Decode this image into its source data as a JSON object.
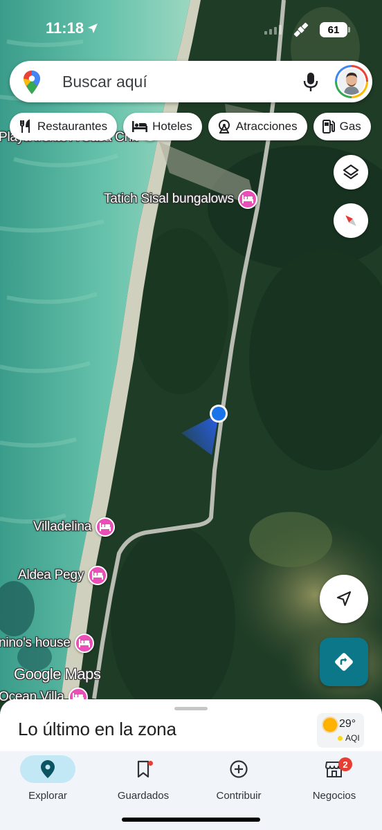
{
  "status_bar": {
    "time": "11:18",
    "battery": "61"
  },
  "search": {
    "placeholder": "Buscar aquí"
  },
  "chips": [
    {
      "label": "Restaurantes",
      "icon": "fork-knife-icon"
    },
    {
      "label": "Hoteles",
      "icon": "bed-icon"
    },
    {
      "label": "Atracciones",
      "icon": "attraction-icon"
    },
    {
      "label": "Gas",
      "icon": "gas-pump-icon"
    }
  ],
  "map": {
    "places": [
      {
        "label": "Playa frente A Casa Chit",
        "type": "place",
        "pin": "purple"
      },
      {
        "label": "Tatich Sisal bungalows",
        "type": "hotel",
        "pin": "pink"
      },
      {
        "label": "Villadelina",
        "type": "hotel",
        "pin": "pink"
      },
      {
        "label": "Aldea Pegy",
        "type": "hotel",
        "pin": "pink"
      },
      {
        "label": "nino's house",
        "type": "hotel",
        "pin": "pink"
      },
      {
        "label": "Ocean Villa",
        "type": "hotel",
        "pin": "pink"
      }
    ],
    "watermark": "Google Maps",
    "colors": {
      "sea": "#4fb59f",
      "forest": "#1f3c26",
      "road": "#b7b9b0",
      "location": "#1a73e8",
      "hotel_pin": "#e94fb7"
    }
  },
  "sheet": {
    "title": "Lo último en la zona",
    "weather": {
      "temp": "29°",
      "aqi_label": "AQI"
    }
  },
  "nav": {
    "items": [
      {
        "label": "Explorar",
        "icon": "explore-pin-icon",
        "active": true
      },
      {
        "label": "Guardados",
        "icon": "bookmark-icon",
        "active": false
      },
      {
        "label": "Contribuir",
        "icon": "add-circle-icon",
        "active": false
      },
      {
        "label": "Negocios",
        "icon": "storefront-icon",
        "active": false,
        "badge": "2"
      }
    ]
  }
}
